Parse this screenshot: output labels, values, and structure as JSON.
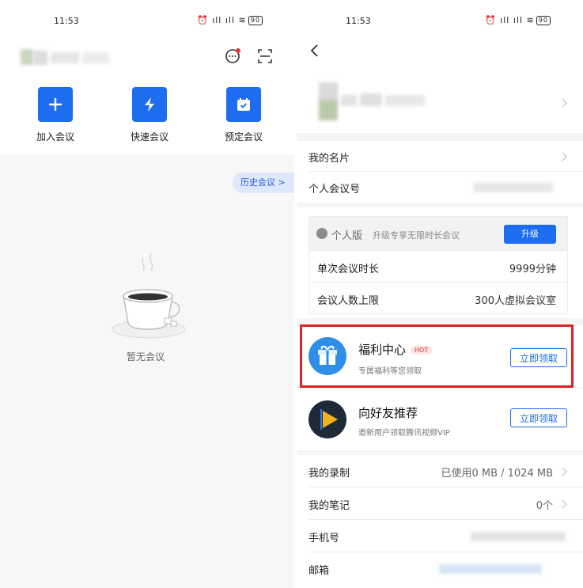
{
  "left_screen": {
    "status_bar": {
      "time": "11:53",
      "battery": "90"
    },
    "header": {
      "user_name_blurred": ""
    },
    "quick_actions": [
      {
        "label": "加入会议",
        "icon": "plus-icon"
      },
      {
        "label": "快速会议",
        "icon": "lightning-icon"
      },
      {
        "label": "预定会议",
        "icon": "calendar-check-icon"
      }
    ],
    "history_pill": "历史会议 >",
    "empty_state": {
      "icon": "coffee-cup-icon",
      "label": "暂无会议"
    }
  },
  "right_screen": {
    "status_bar": {
      "time": "11:53",
      "battery": "90"
    },
    "profile": {
      "name_blurred": ""
    },
    "rows_top": [
      {
        "label": "我的名片",
        "value": ""
      },
      {
        "label": "个人会议号",
        "value": ""
      }
    ],
    "plan": {
      "edition": "个人版",
      "desc": "升级专享无限时长会议",
      "upgrade_label": "升级",
      "rows": [
        {
          "label": "单次会议时长",
          "value": "9999分钟"
        },
        {
          "label": "会议人数上限",
          "value": "300人虚拟会议室"
        }
      ]
    },
    "benefits": {
      "title": "福利中心",
      "hot": "HOT",
      "sub": "专属福利等您领取",
      "button": "立即领取"
    },
    "referral": {
      "title": "向好友推荐",
      "sub": "邀新用户领取腾讯视频VIP",
      "button": "立即领取"
    },
    "rows_bottom": [
      {
        "label": "我的录制",
        "value": "已使用0 MB / 1024 MB"
      },
      {
        "label": "我的笔记",
        "value": "0个"
      },
      {
        "label": "手机号",
        "value": ""
      },
      {
        "label": "邮箱",
        "value": ""
      }
    ]
  },
  "colors": {
    "accent": "#1e6cf0",
    "highlight": "#e02020",
    "hot": "#e23a3a"
  }
}
